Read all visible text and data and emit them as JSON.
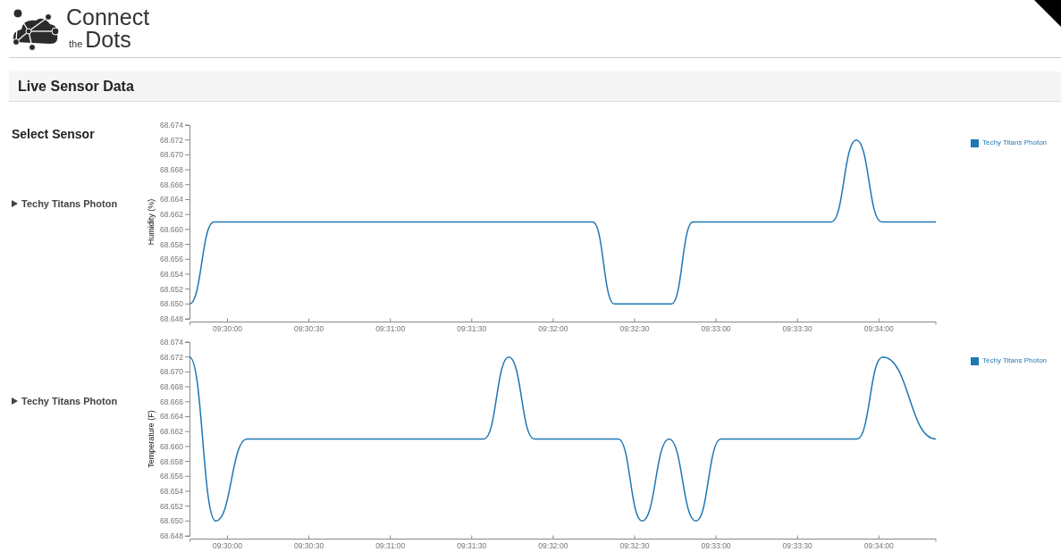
{
  "brand": {
    "line_1": "Connect",
    "small": "the",
    "line_2": "Dots"
  },
  "panel": {
    "title": "Live Sensor Data"
  },
  "sidebar": {
    "heading": "Select Sensor",
    "sensors": [
      {
        "label": "Techy Titans Photon",
        "expanded": false
      },
      {
        "label": "Techy Titans Photon",
        "expanded": false
      }
    ]
  },
  "charts": [
    {
      "chart_data": {
        "type": "line",
        "ylabel": "Humidity (%)",
        "x": [
          34186,
          34195,
          34334.6,
          34342.5,
          34363.6,
          34371.5,
          34422.5,
          34431.7,
          34441,
          34461
        ],
        "series": [
          {
            "name": "Techy Titans Photon",
            "color": "#1f77b4",
            "values": [
              68.65,
              68.661,
              68.661,
              68.65,
              68.65,
              68.661,
              68.661,
              68.672,
              68.661,
              68.661
            ]
          }
        ],
        "xlim": [
          34186,
          34461
        ],
        "ylim": [
          68.648,
          68.674
        ],
        "xticks": [
          {
            "value": 34200,
            "label": "09:30:00"
          },
          {
            "value": 34230,
            "label": "09:30:30"
          },
          {
            "value": 34260,
            "label": "09:31:00"
          },
          {
            "value": 34290,
            "label": "09:31:30"
          },
          {
            "value": 34320,
            "label": "09:32:00"
          },
          {
            "value": 34350,
            "label": "09:32:30"
          },
          {
            "value": 34380,
            "label": "09:33:00"
          },
          {
            "value": 34410,
            "label": "09:33:30"
          },
          {
            "value": 34440,
            "label": "09:34:00"
          }
        ],
        "yticks": [
          {
            "value": 68.648,
            "label": "68.648"
          },
          {
            "value": 68.65,
            "label": "68.650"
          },
          {
            "value": 68.652,
            "label": "68.652"
          },
          {
            "value": 68.654,
            "label": "68.654"
          },
          {
            "value": 68.656,
            "label": "68.656"
          },
          {
            "value": 68.658,
            "label": "68.658"
          },
          {
            "value": 68.66,
            "label": "68.660"
          },
          {
            "value": 68.662,
            "label": "68.662"
          },
          {
            "value": 68.664,
            "label": "68.664"
          },
          {
            "value": 68.666,
            "label": "68.666"
          },
          {
            "value": 68.668,
            "label": "68.668"
          },
          {
            "value": 68.67,
            "label": "68.670"
          },
          {
            "value": 68.672,
            "label": "68.672"
          },
          {
            "value": 68.674,
            "label": "68.674"
          }
        ]
      }
    },
    {
      "chart_data": {
        "type": "line",
        "ylabel": "Temperature (F)",
        "x": [
          34186,
          34195.7,
          34207.2,
          34294.5,
          34303.7,
          34313,
          34344,
          34352.8,
          34362.7,
          34372.6,
          34381.8,
          34432,
          34441.4,
          34461
        ],
        "series": [
          {
            "name": "Techy Titans Photon",
            "color": "#1f77b4",
            "values": [
              68.672,
              68.65,
              68.661,
              68.661,
              68.672,
              68.661,
              68.661,
              68.65,
              68.661,
              68.65,
              68.661,
              68.661,
              68.672,
              68.661
            ]
          }
        ],
        "xlim": [
          34186,
          34461
        ],
        "ylim": [
          68.648,
          68.674
        ],
        "xticks": [
          {
            "value": 34200,
            "label": "09:30:00"
          },
          {
            "value": 34230,
            "label": "09:30:30"
          },
          {
            "value": 34260,
            "label": "09:31:00"
          },
          {
            "value": 34290,
            "label": "09:31:30"
          },
          {
            "value": 34320,
            "label": "09:32:00"
          },
          {
            "value": 34350,
            "label": "09:32:30"
          },
          {
            "value": 34380,
            "label": "09:33:00"
          },
          {
            "value": 34410,
            "label": "09:33:30"
          },
          {
            "value": 34440,
            "label": "09:34:00"
          }
        ],
        "yticks": [
          {
            "value": 68.648,
            "label": "68.648"
          },
          {
            "value": 68.65,
            "label": "68.650"
          },
          {
            "value": 68.652,
            "label": "68.652"
          },
          {
            "value": 68.654,
            "label": "68.654"
          },
          {
            "value": 68.656,
            "label": "68.656"
          },
          {
            "value": 68.658,
            "label": "68.658"
          },
          {
            "value": 68.66,
            "label": "68.660"
          },
          {
            "value": 68.662,
            "label": "68.662"
          },
          {
            "value": 68.664,
            "label": "68.664"
          },
          {
            "value": 68.666,
            "label": "68.666"
          },
          {
            "value": 68.668,
            "label": "68.668"
          },
          {
            "value": 68.67,
            "label": "68.670"
          },
          {
            "value": 68.672,
            "label": "68.672"
          },
          {
            "value": 68.674,
            "label": "68.674"
          }
        ]
      }
    }
  ]
}
